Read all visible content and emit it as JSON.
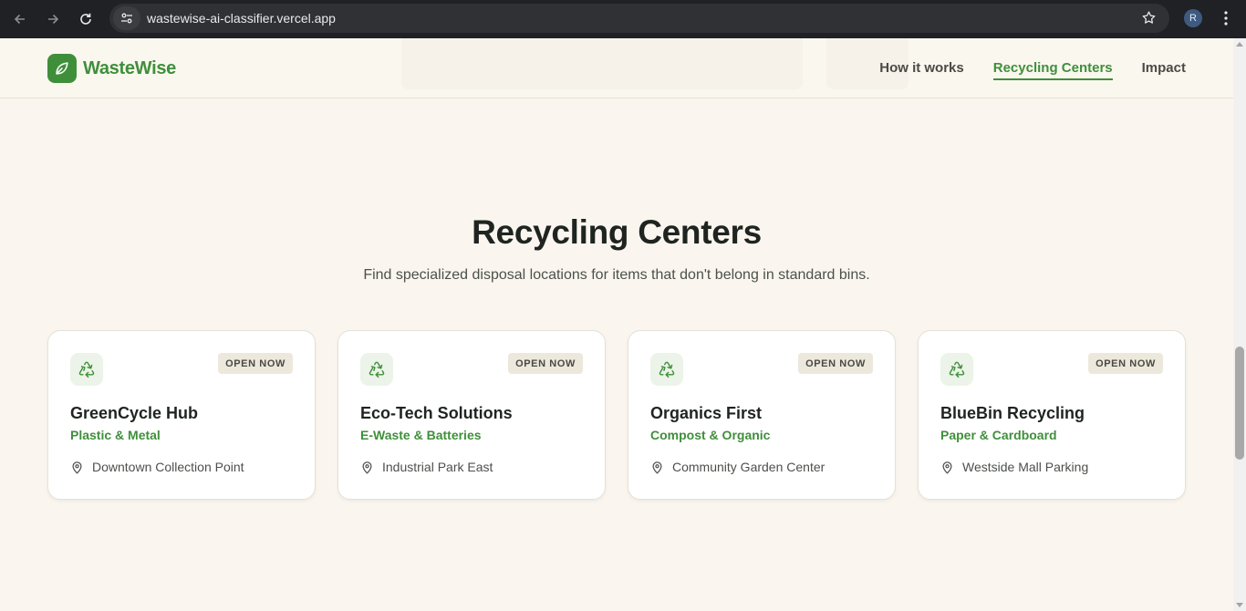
{
  "browser": {
    "url": "wastewise-ai-classifier.vercel.app",
    "profile_initial": "R"
  },
  "header": {
    "logo_text": "WasteWise",
    "nav": [
      {
        "label": "How it works",
        "active": false
      },
      {
        "label": "Recycling Centers",
        "active": true
      },
      {
        "label": "Impact",
        "active": false
      }
    ]
  },
  "section": {
    "title": "Recycling Centers",
    "subtitle": "Find specialized disposal locations for items that don't belong in standard bins."
  },
  "centers": [
    {
      "name": "GreenCycle Hub",
      "category": "Plastic & Metal",
      "status": "OPEN NOW",
      "location": "Downtown Collection Point"
    },
    {
      "name": "Eco-Tech Solutions",
      "category": "E-Waste & Batteries",
      "status": "OPEN NOW",
      "location": "Industrial Park East"
    },
    {
      "name": "Organics First",
      "category": "Compost & Organic",
      "status": "OPEN NOW",
      "location": "Community Garden Center"
    },
    {
      "name": "BlueBin Recycling",
      "category": "Paper & Cardboard",
      "status": "OPEN NOW",
      "location": "Westside Mall Parking"
    }
  ],
  "colors": {
    "brand": "#3f8f3a",
    "background": "#faf6ef",
    "badge_bg": "#ece8dc"
  }
}
